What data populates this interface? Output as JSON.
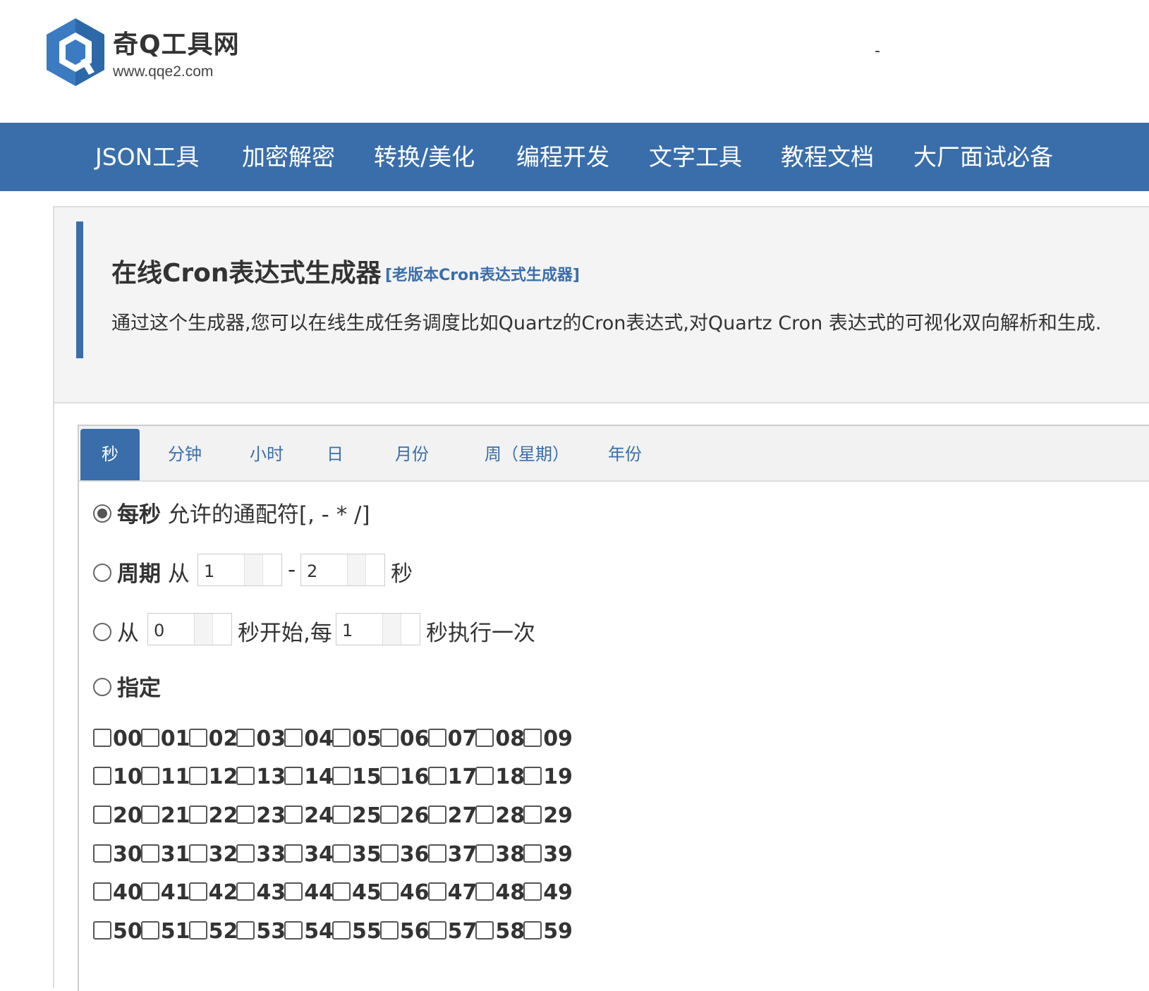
{
  "header": {
    "site_name": "奇Q工具网",
    "site_url": "www.qqe2.com",
    "right_text": "-"
  },
  "nav": [
    "JSON工具",
    "加密解密",
    "转换/美化",
    "编程开发",
    "文字工具",
    "教程文档",
    "大厂面试必备"
  ],
  "intro": {
    "title": "在线Cron表达式生成器",
    "old_version_link": "[老版本Cron表达式生成器]",
    "description": "通过这个生成器,您可以在线生成任务调度比如Quartz的Cron表达式,对Quartz Cron 表达式的可视化双向解析和生成."
  },
  "tabs": [
    "秒",
    "分钟",
    "小时",
    "日",
    "月份",
    "周（星期）",
    "年份"
  ],
  "active_tab": "秒",
  "options": {
    "every": {
      "label": "每秒",
      "desc": "允许的通配符[, - * /]",
      "selected": true
    },
    "period": {
      "label": "周期",
      "from_text": "从",
      "from_value": "1",
      "dash": "-",
      "to_value": "2",
      "unit": "秒",
      "selected": false
    },
    "increment": {
      "from_text": "从",
      "start_value": "0",
      "mid_text": "秒开始,每",
      "step_value": "1",
      "end_text": "秒执行一次",
      "selected": false
    },
    "specify": {
      "label": "指定",
      "selected": false
    }
  },
  "seconds": [
    [
      "00",
      "01",
      "02",
      "03",
      "04",
      "05",
      "06",
      "07",
      "08",
      "09"
    ],
    [
      "10",
      "11",
      "12",
      "13",
      "14",
      "15",
      "16",
      "17",
      "18",
      "19"
    ],
    [
      "20",
      "21",
      "22",
      "23",
      "24",
      "25",
      "26",
      "27",
      "28",
      "29"
    ],
    [
      "30",
      "31",
      "32",
      "33",
      "34",
      "35",
      "36",
      "37",
      "38",
      "39"
    ],
    [
      "40",
      "41",
      "42",
      "43",
      "44",
      "45",
      "46",
      "47",
      "48",
      "49"
    ],
    [
      "50",
      "51",
      "52",
      "53",
      "54",
      "55",
      "56",
      "57",
      "58",
      "59"
    ]
  ],
  "colors": {
    "brand": "#3a6eaa",
    "panel_bg": "#f4f4f4"
  }
}
